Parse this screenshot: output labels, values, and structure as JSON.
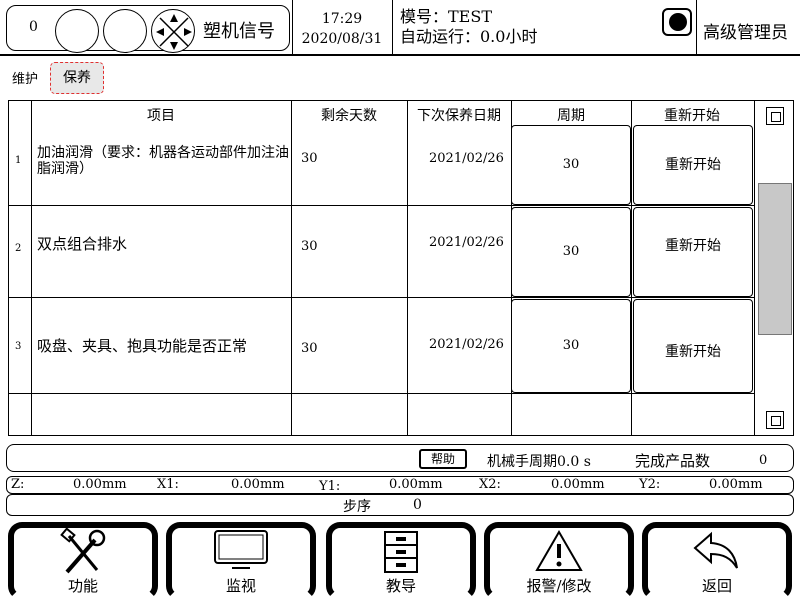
{
  "header": {
    "counter": "0",
    "signal_label": "塑机信号",
    "time": "17:29",
    "date": "2020/08/31",
    "mold_label": "模号：TEST",
    "auto_run_label": "自动运行：0.0小时",
    "user_role": "高级管理员"
  },
  "tabs": {
    "section_label": "维护",
    "active_tab": "保养"
  },
  "table": {
    "headers": [
      "项目",
      "剩余天数",
      "下次保养日期",
      "周期",
      "重新开始"
    ],
    "rows": [
      {
        "index": "1",
        "item": "加油润滑（要求：机器各运动部件加注油脂润滑）",
        "days": "30",
        "next_date": "2021/02/26",
        "cycle": "30",
        "restart": "重新开始"
      },
      {
        "index": "2",
        "item": "双点组合排水",
        "days": "30",
        "next_date": "2021/02/26",
        "cycle": "30",
        "restart": "重新开始"
      },
      {
        "index": "3",
        "item": "吸盘、夹具、抱具功能是否正常",
        "days": "30",
        "next_date": "2021/02/26",
        "cycle": "30",
        "restart": "重新开始"
      }
    ]
  },
  "info": {
    "help_label": "帮助",
    "cycle_label": "机械手周期0.0 s",
    "products_label": "完成产品数",
    "products_value": "0"
  },
  "coords": {
    "z_label": "Z:",
    "z_value": "0.00mm",
    "x1_label": "X1:",
    "x1_value": "0.00mm",
    "y1_label": "Y1:",
    "y1_value": "0.00mm",
    "x2_label": "X2:",
    "x2_value": "0.00mm",
    "y2_label": "Y2:",
    "y2_value": "0.00mm"
  },
  "step": {
    "label": "步序",
    "value": "0"
  },
  "nav": {
    "function_label": "功能",
    "monitor_label": "监视",
    "teach_label": "教导",
    "alarm_label": "报警/修改",
    "back_label": "返回"
  }
}
